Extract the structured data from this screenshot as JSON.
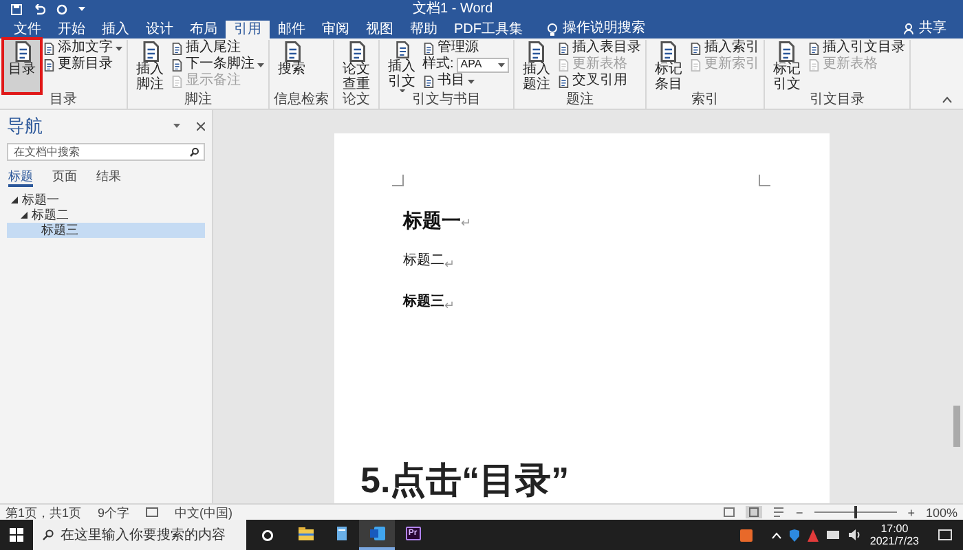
{
  "window": {
    "title": "文档1 - Word"
  },
  "tabs": [
    {
      "label": "文件",
      "selected": false
    },
    {
      "label": "开始",
      "selected": false
    },
    {
      "label": "插入",
      "selected": false
    },
    {
      "label": "设计",
      "selected": false
    },
    {
      "label": "布局",
      "selected": false
    },
    {
      "label": "引用",
      "selected": true
    },
    {
      "label": "邮件",
      "selected": false
    },
    {
      "label": "审阅",
      "selected": false
    },
    {
      "label": "视图",
      "selected": false
    },
    {
      "label": "帮助",
      "selected": false
    },
    {
      "label": "PDF工具集",
      "selected": false
    }
  ],
  "tell_me": "操作说明搜索",
  "share": "共享",
  "ribbon_groups": [
    {
      "label": "目录",
      "items": [
        {
          "kind": "large",
          "label": "目录",
          "highlighted": true,
          "disabled": false,
          "dropdown": false
        },
        {
          "kind": "small",
          "label": "添加文字",
          "highlighted": false,
          "disabled": false,
          "dropdown": true
        },
        {
          "kind": "small",
          "label": "更新目录",
          "highlighted": false,
          "disabled": false,
          "dropdown": false
        }
      ]
    },
    {
      "label": "脚注",
      "items": [
        {
          "kind": "large",
          "label": "插入脚注",
          "highlighted": false,
          "disabled": false,
          "dropdown": false
        },
        {
          "kind": "small",
          "label": "插入尾注",
          "highlighted": false,
          "disabled": false,
          "dropdown": false
        },
        {
          "kind": "small",
          "label": "下一条脚注",
          "highlighted": false,
          "disabled": false,
          "dropdown": true
        },
        {
          "kind": "small",
          "label": "显示备注",
          "highlighted": false,
          "disabled": true,
          "dropdown": false
        }
      ]
    },
    {
      "label": "信息检索",
      "items": [
        {
          "kind": "large",
          "label": "搜索",
          "highlighted": false,
          "disabled": false,
          "dropdown": false
        }
      ]
    },
    {
      "label": "论文",
      "items": [
        {
          "kind": "large",
          "label": "论文查重",
          "highlighted": false,
          "disabled": false,
          "dropdown": false
        }
      ]
    },
    {
      "label": "引文与书目",
      "items": [
        {
          "kind": "large",
          "label": "插入引文",
          "highlighted": false,
          "disabled": false,
          "dropdown": true
        },
        {
          "kind": "small",
          "label": "管理源",
          "highlighted": false,
          "disabled": false,
          "dropdown": false
        },
        {
          "kind": "select",
          "label": "样式:",
          "value": "APA",
          "highlighted": false,
          "disabled": false,
          "dropdown": true
        },
        {
          "kind": "small",
          "label": "书目",
          "highlighted": false,
          "disabled": false,
          "dropdown": true
        }
      ]
    },
    {
      "label": "题注",
      "items": [
        {
          "kind": "large",
          "label": "插入题注",
          "highlighted": false,
          "disabled": false,
          "dropdown": false
        },
        {
          "kind": "small",
          "label": "插入表目录",
          "highlighted": false,
          "disabled": false,
          "dropdown": false
        },
        {
          "kind": "small",
          "label": "更新表格",
          "highlighted": false,
          "disabled": true,
          "dropdown": false
        },
        {
          "kind": "small",
          "label": "交叉引用",
          "highlighted": false,
          "disabled": false,
          "dropdown": false
        }
      ]
    },
    {
      "label": "索引",
      "items": [
        {
          "kind": "large",
          "label": "标记条目",
          "highlighted": false,
          "disabled": false,
          "dropdown": false
        },
        {
          "kind": "small",
          "label": "插入索引",
          "highlighted": false,
          "disabled": false,
          "dropdown": false
        },
        {
          "kind": "small",
          "label": "更新索引",
          "highlighted": false,
          "disabled": true,
          "dropdown": false
        }
      ]
    },
    {
      "label": "引文目录",
      "items": [
        {
          "kind": "large",
          "label": "标记引文",
          "highlighted": false,
          "disabled": false,
          "dropdown": false
        },
        {
          "kind": "small",
          "label": "插入引文目录",
          "highlighted": false,
          "disabled": false,
          "dropdown": false
        },
        {
          "kind": "small",
          "label": "更新表格",
          "highlighted": false,
          "disabled": true,
          "dropdown": false
        }
      ]
    }
  ],
  "navigation": {
    "title": "导航",
    "search": {
      "placeholder": "在文档中搜索"
    },
    "tabs": [
      {
        "label": "标题",
        "selected": true
      },
      {
        "label": "页面",
        "selected": false
      },
      {
        "label": "结果",
        "selected": false
      }
    ],
    "tree": [
      {
        "label": "标题一",
        "selected": false,
        "expanded": true,
        "children": [
          {
            "label": "标题二",
            "selected": false,
            "expanded": true,
            "children": [
              {
                "label": "标题三",
                "selected": true
              }
            ]
          }
        ]
      }
    ]
  },
  "document": {
    "paragraphs": [
      {
        "kind": "title1",
        "text": "标题一",
        "mark": "↵"
      },
      {
        "kind": "title2",
        "text": "标题二",
        "mark": "↵"
      },
      {
        "kind": "title3",
        "text": "标题三",
        "mark": "↵"
      }
    ]
  },
  "caption": "5.点击“目录”",
  "status_bar": {
    "items": [
      "第1页，共1页",
      "9个字"
    ],
    "language": "中文(中国)",
    "zoom": {
      "out": "−",
      "in": "+",
      "level": 0.5,
      "reading": "100%"
    }
  },
  "taskbar": {
    "search": {
      "placeholder": "在这里输入你要搜索的内容"
    },
    "apps": [
      {
        "kind": "folder",
        "active": false
      },
      {
        "kind": "notes",
        "active": false
      },
      {
        "kind": "word",
        "active": true
      },
      {
        "kind": "premiere",
        "label": "Pr",
        "active": false
      }
    ],
    "time": "17:00",
    "date": "2021/7/23"
  }
}
